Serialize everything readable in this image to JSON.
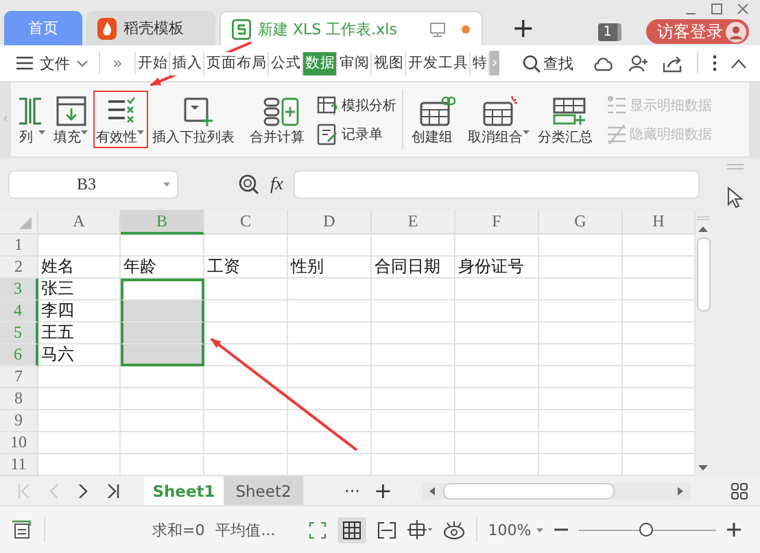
{
  "window": {
    "tabs": [
      {
        "label": "首页",
        "kind": "home",
        "selected": false
      },
      {
        "label": "稻壳模板",
        "kind": "template",
        "selected": false
      },
      {
        "label": "新建 XLS 工作表.xls",
        "kind": "document",
        "selected": true
      }
    ],
    "new_tab": "+",
    "badge": "1",
    "login_button": "访客登录"
  },
  "menu": {
    "file": "文件",
    "more": "»",
    "items": [
      {
        "label": "开始",
        "selected": false
      },
      {
        "label": "插入",
        "selected": false
      },
      {
        "label": "页面布局",
        "selected": false
      },
      {
        "label": "公式",
        "selected": false
      },
      {
        "label": "数据",
        "selected": true
      },
      {
        "label": "审阅",
        "selected": false
      },
      {
        "label": "视图",
        "selected": false
      },
      {
        "label": "开发工具",
        "selected": false
      },
      {
        "label": "特",
        "selected": false
      }
    ],
    "scroll": "›",
    "search": "查找"
  },
  "ribbon": {
    "scroll_left": "‹",
    "items": [
      {
        "kind": "big",
        "label": "列",
        "dropdown": true,
        "annotated": false
      },
      {
        "kind": "big",
        "label": "填充",
        "dropdown": true,
        "annotated": false
      },
      {
        "kind": "big",
        "label": "有效性",
        "dropdown": true,
        "annotated": true
      },
      {
        "kind": "big",
        "label": "插入下拉列表",
        "dropdown": false,
        "annotated": false
      },
      {
        "kind": "big",
        "label": "合并计算",
        "dropdown": false,
        "annotated": false
      },
      {
        "kind": "stack",
        "entries": [
          {
            "label": "模拟分析",
            "disabled": false
          },
          {
            "label": "记录单",
            "disabled": false
          }
        ]
      },
      {
        "kind": "separator"
      },
      {
        "kind": "big",
        "label": "创建组",
        "dropdown": false,
        "annotated": false
      },
      {
        "kind": "big",
        "label": "取消组合",
        "dropdown": true,
        "annotated": false
      },
      {
        "kind": "big",
        "label": "分类汇总",
        "dropdown": false,
        "annotated": false
      },
      {
        "kind": "stack",
        "entries": [
          {
            "label": "显示明细数据",
            "disabled": true
          },
          {
            "label": "隐藏明细数据",
            "disabled": true
          }
        ]
      }
    ]
  },
  "formula_bar": {
    "name_box": "B3",
    "fx": "fx"
  },
  "grid": {
    "columns": [
      {
        "label": "A",
        "selected": false
      },
      {
        "label": "B",
        "selected": true
      },
      {
        "label": "C",
        "selected": false
      },
      {
        "label": "D",
        "selected": false
      },
      {
        "label": "E",
        "selected": false
      },
      {
        "label": "F",
        "selected": false
      },
      {
        "label": "G",
        "selected": false
      },
      {
        "label": "H",
        "selected": false
      }
    ],
    "rows": [
      {
        "label": "1",
        "selected": false
      },
      {
        "label": "2",
        "selected": false,
        "cells": [
          {
            "text": "姓名"
          },
          {
            "text": "年龄"
          },
          {
            "text": "工资"
          },
          {
            "text": "性别"
          },
          {
            "text": "合同日期"
          },
          {
            "text": "身份证号"
          }
        ]
      },
      {
        "label": "3",
        "selected": true,
        "cells": [
          {
            "text": "张三"
          },
          {
            "selected": true,
            "active": true
          }
        ]
      },
      {
        "label": "4",
        "selected": true,
        "cells": [
          {
            "text": "李四"
          },
          {
            "selected": true,
            "active": false
          }
        ]
      },
      {
        "label": "5",
        "selected": true,
        "cells": [
          {
            "text": "王五"
          },
          {
            "selected": true,
            "active": false
          }
        ]
      },
      {
        "label": "6",
        "selected": true,
        "cells": [
          {
            "text": "马六"
          },
          {
            "selected": true,
            "active": false
          }
        ]
      },
      {
        "label": "7",
        "selected": false
      },
      {
        "label": "8",
        "selected": false
      },
      {
        "label": "9",
        "selected": false
      },
      {
        "label": "10",
        "selected": false
      },
      {
        "label": "11",
        "selected": false
      }
    ]
  },
  "sheets": {
    "tabs": [
      {
        "label": "Sheet1",
        "selected": true
      },
      {
        "label": "Sheet2",
        "selected": false
      }
    ],
    "more": "···",
    "add": "+"
  },
  "status_bar": {
    "sum": "求和=0",
    "average": "平均值...",
    "zoom": "100%",
    "zoom_level": {
      "level": 0.49
    }
  }
}
